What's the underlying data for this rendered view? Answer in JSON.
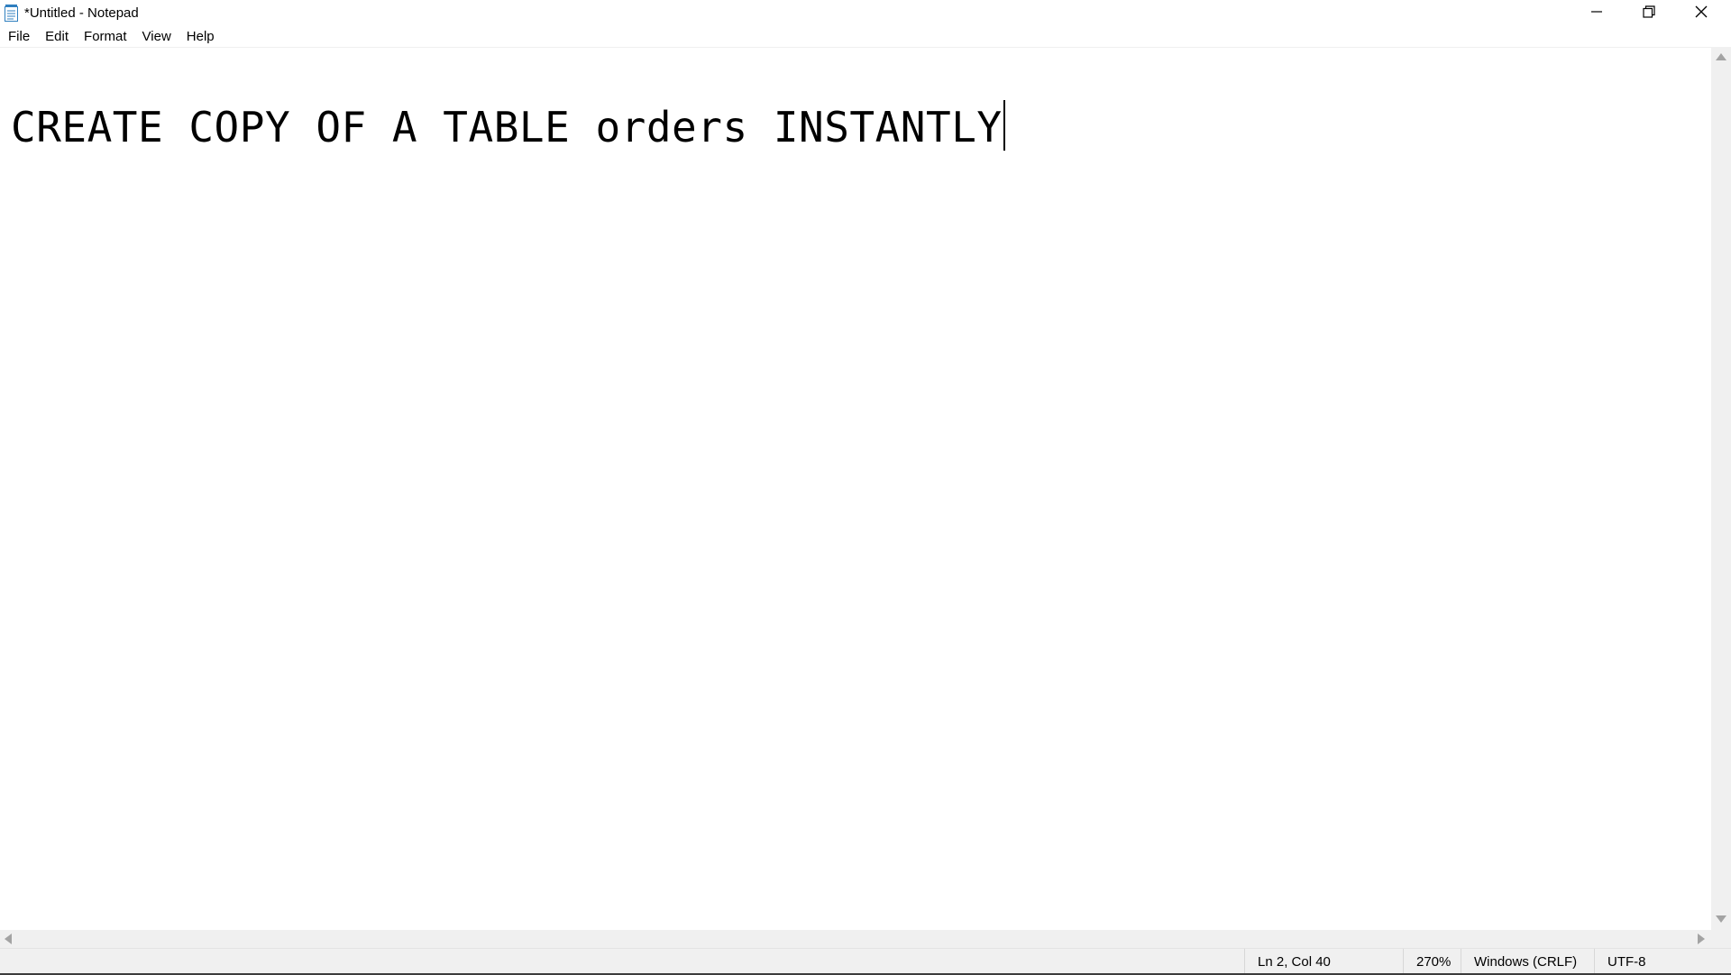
{
  "window": {
    "title": "*Untitled - Notepad",
    "app_icon": "notepad-icon",
    "controls": {
      "minimize_icon": "minimize-icon",
      "maximize_icon": "restore-icon",
      "close_icon": "close-icon"
    }
  },
  "menu": {
    "items": [
      {
        "label": "File"
      },
      {
        "label": "Edit"
      },
      {
        "label": "Format"
      },
      {
        "label": "View"
      },
      {
        "label": "Help"
      }
    ]
  },
  "editor": {
    "text": "CREATE COPY OF A TABLE orders INSTANTLY"
  },
  "status": {
    "position": "Ln 2, Col 40",
    "zoom": "270%",
    "line_ending": "Windows (CRLF)",
    "encoding": "UTF-8"
  },
  "colors": {
    "background": "#ffffff",
    "chrome": "#f0f0f0",
    "text": "#000000",
    "scroll_arrow": "#a3a3a3",
    "icon_blue": "#2f7fbf"
  }
}
